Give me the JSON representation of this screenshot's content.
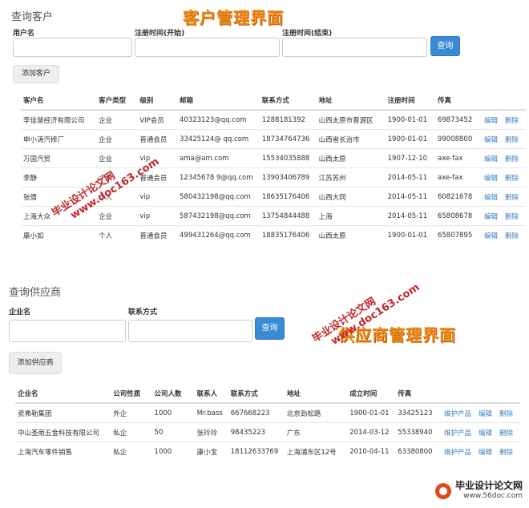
{
  "customer": {
    "title": "查询客户",
    "username_label": "用户名",
    "reg_start_label": "注册时间(开始)",
    "reg_end_label": "注册时间(结束)",
    "query_button": "查询",
    "add_button": "添加客户",
    "columns": [
      "客户名",
      "客户类型",
      "级别",
      "邮箱",
      "联系方式",
      "地址",
      "注册时间",
      "传真"
    ],
    "edit_label": "编辑",
    "delete_label": "删除",
    "rows": [
      [
        "李佳慧经济有限公司",
        "企业",
        "VIP会员",
        "40323123@qq.com",
        "1288181392",
        "山西太原市晋源区",
        "1900-01-01",
        "69873452"
      ],
      [
        "申小涛汽修厂",
        "企业",
        "普通会员",
        "33425124@ qq.com",
        "18734764736",
        "山西省长治市",
        "1900-01-01",
        "99008800"
      ],
      [
        "万国汽贸",
        "企业",
        "vip",
        "ama@am.com",
        "15534035888",
        "山西太原",
        "1907-12-10",
        "axe-fax"
      ],
      [
        "李静",
        "个人",
        "普通会员",
        "12345678 9@qq.com",
        "13903406789",
        "江苏苏州",
        "2014-05-11",
        "axe-fax"
      ],
      [
        "张倩",
        "个人",
        "vip",
        "580432198@qq.com",
        "18635176406",
        "山西大同",
        "2014-05-11",
        "60821678"
      ],
      [
        "上海大众",
        "企业",
        "vip",
        "587432198@qq.com",
        "13754844488",
        "上海",
        "2014-05-11",
        "65808678"
      ],
      [
        "康小如",
        "个人",
        "普通会员",
        "499431264@qq.com",
        "18835176406",
        "山西太原",
        "1900-01-01",
        "65807895"
      ]
    ]
  },
  "supplier": {
    "title": "查询供应商",
    "company_label": "企业名",
    "contact_label": "联系方式",
    "query_button": "查询",
    "add_button": "添加供应商",
    "columns": [
      "企业名",
      "公司性质",
      "公司人数",
      "联系人",
      "联系方式",
      "地址",
      "成立时间",
      "传真"
    ],
    "maintain_label": "维护产品",
    "edit_label": "编辑",
    "delete_label": "删除",
    "rows": [
      [
        "瓷弗勒集团",
        "外企",
        "1000",
        "Mr.bass",
        "667668223",
        "北京劲松路",
        "1900-01-01",
        "33425123"
      ],
      [
        "中山圣雨五金科技有限公司",
        "私企",
        "50",
        "张玲玲",
        "98435223",
        "广东",
        "2014-03-12",
        "55338940"
      ],
      [
        "上海汽车零件销售",
        "私企",
        "1000",
        "康小宝",
        "18112633769",
        "上海浦东区12号",
        "2010-04-11",
        "63380800"
      ]
    ]
  },
  "watermarks": {
    "customer_banner": "客户管理界面",
    "supplier_banner": "供应商管理界面",
    "site_cn": "毕业设计论文网",
    "site_url": "www.doc163.com",
    "logo_cn": "毕业设计论文网",
    "logo_url": "www.56doc.com"
  }
}
